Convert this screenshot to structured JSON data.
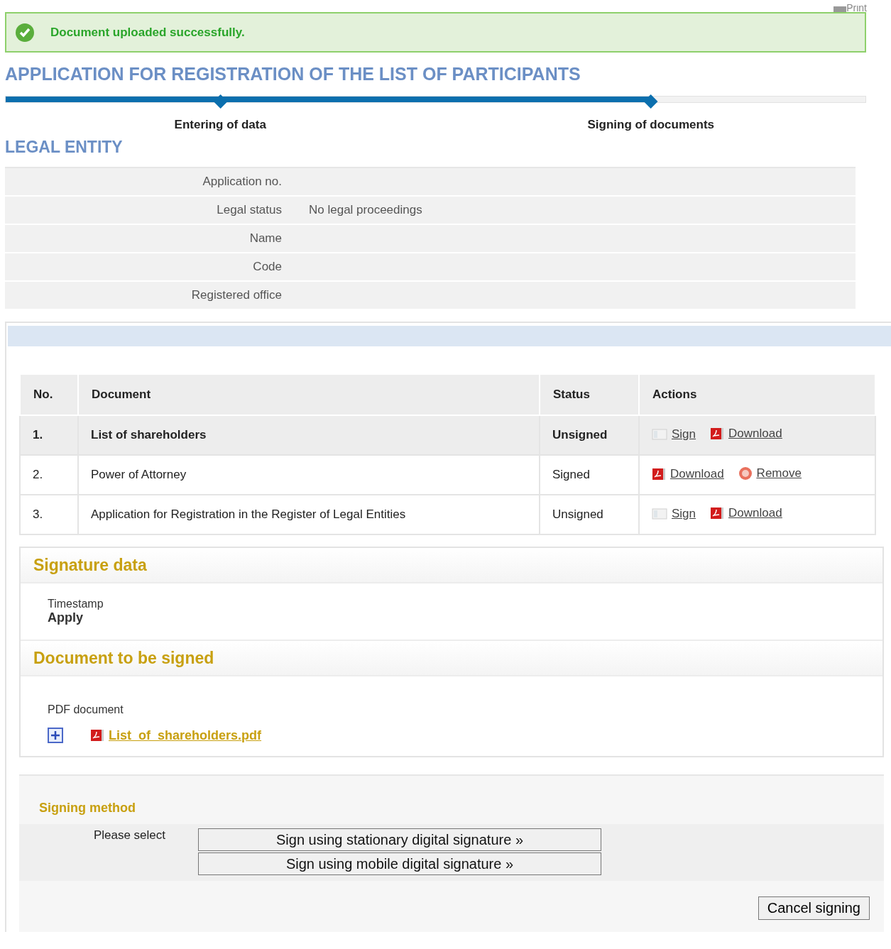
{
  "print_link": "Print",
  "alert": {
    "message": "Document uploaded successfully."
  },
  "title": "APPLICATION FOR REGISTRATION OF THE LIST OF PARTICIPANTS",
  "progress": {
    "level": 0.75,
    "steps": [
      {
        "label": "Entering of data"
      },
      {
        "label": "Signing of documents"
      }
    ]
  },
  "legal_entity": {
    "heading": "LEGAL ENTITY",
    "fields": [
      {
        "label": "Application no."
      },
      {
        "label": "Legal status",
        "value": "No legal proceedings"
      },
      {
        "label": "Name"
      },
      {
        "label": "Code"
      },
      {
        "label": "Registered office"
      }
    ]
  },
  "documents": {
    "columns": [
      "No.",
      "Document",
      "Status",
      "Actions"
    ],
    "rows": [
      {
        "no": "1.",
        "document": "List of shareholders",
        "status": "Unsigned",
        "selected": true,
        "actions": [
          {
            "kind": "sign",
            "label": "Sign"
          },
          {
            "kind": "download",
            "label": "Download"
          }
        ]
      },
      {
        "no": "2.",
        "document": "Power of Attorney",
        "status": "Signed",
        "selected": false,
        "actions": [
          {
            "kind": "download",
            "label": "Download"
          },
          {
            "kind": "remove",
            "label": "Remove"
          }
        ]
      },
      {
        "no": "3.",
        "document": "Application for Registration in the Register of Legal Entities",
        "status": "Unsigned",
        "selected": false,
        "actions": [
          {
            "kind": "sign",
            "label": "Sign"
          },
          {
            "kind": "download",
            "label": "Download"
          }
        ]
      }
    ]
  },
  "signature_data": {
    "heading": "Signature data",
    "label": "Timestamp",
    "value": "Apply"
  },
  "document_to_sign": {
    "heading": "Document to be signed",
    "label": "PDF document",
    "file": "List_of_shareholders.pdf"
  },
  "signing_method": {
    "heading": "Signing method",
    "prompt": "Please select",
    "buttons": [
      {
        "label": "Sign using stationary digital signature",
        "mark": "»"
      },
      {
        "label": "Sign using mobile digital signature",
        "mark": "»"
      }
    ],
    "cancel": "Cancel signing"
  }
}
